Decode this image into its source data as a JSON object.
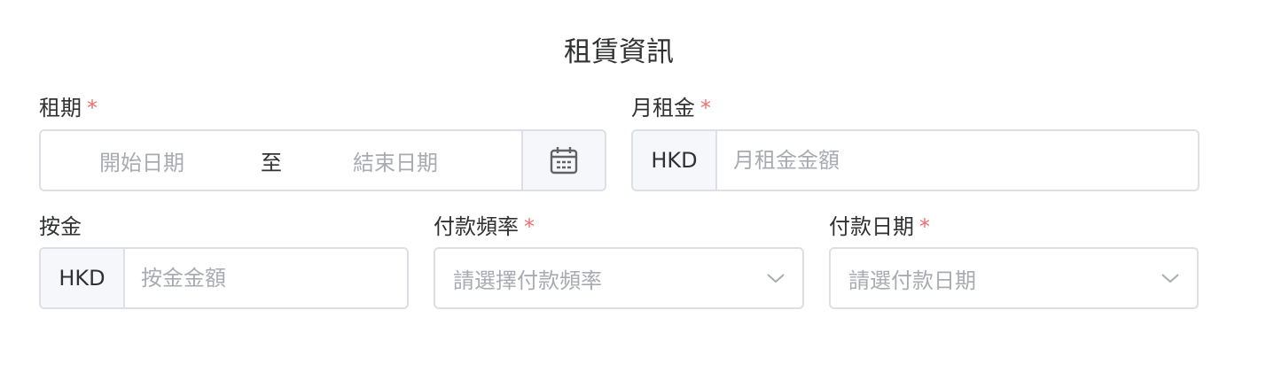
{
  "section": {
    "title": "租賃資訊"
  },
  "lease_term": {
    "label": "租期",
    "required_mark": "*",
    "start_placeholder": "開始日期",
    "separator": "至",
    "end_placeholder": "結束日期",
    "icon": "calendar-icon"
  },
  "monthly_rent": {
    "label": "月租金",
    "required_mark": "*",
    "currency": "HKD",
    "placeholder": "月租金金額"
  },
  "deposit": {
    "label": "按金",
    "currency": "HKD",
    "placeholder": "按金金額"
  },
  "payment_frequency": {
    "label": "付款頻率",
    "required_mark": "*",
    "placeholder": "請選擇付款頻率",
    "icon": "chevron-down-icon"
  },
  "payment_date": {
    "label": "付款日期",
    "required_mark": "*",
    "placeholder": "請選付款日期",
    "icon": "chevron-down-icon"
  },
  "colors": {
    "text": "#303133",
    "placeholder": "#a8abb2",
    "border": "#dcdfe6",
    "required": "#f56c6c",
    "addon_bg": "#f5f7fa"
  }
}
